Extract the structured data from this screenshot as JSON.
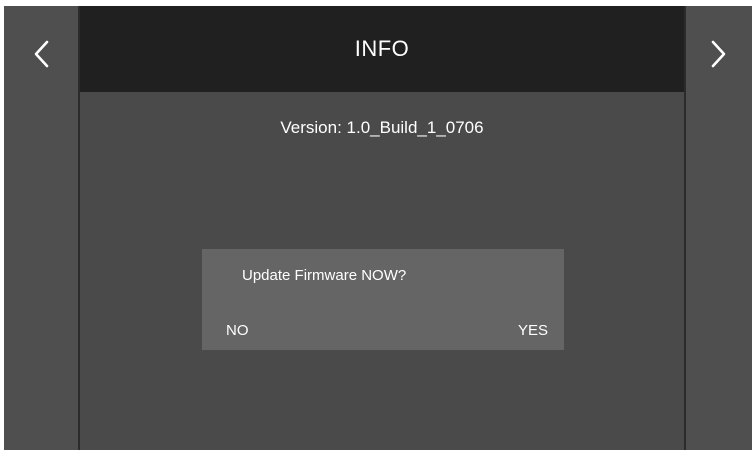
{
  "header": {
    "title": "INFO"
  },
  "nav": {
    "prev_icon": "chevron-left-icon",
    "next_icon": "chevron-right-icon"
  },
  "main": {
    "version_text": "Version: 1.0_Build_1_0706"
  },
  "dialog": {
    "message": "Update Firmware NOW?",
    "no_label": "NO",
    "yes_label": "YES"
  },
  "colors": {
    "header_bg": "#202020",
    "panel_bg": "#4a4a4a",
    "dialog_bg": "#656565",
    "text": "#ffffff"
  }
}
